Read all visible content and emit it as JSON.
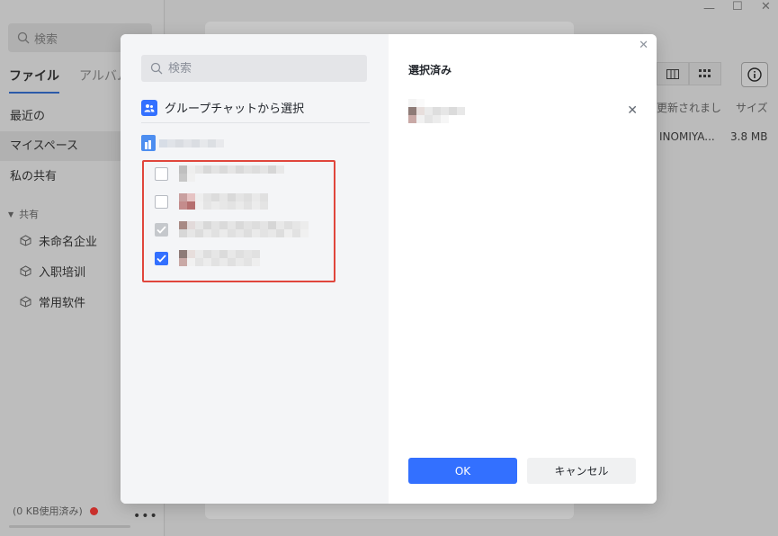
{
  "sidebar": {
    "search_placeholder": "検索",
    "tabs": [
      {
        "label": "ファイル",
        "active": true
      },
      {
        "label": "アルバム",
        "active": false
      }
    ],
    "items": [
      {
        "label": "最近の"
      },
      {
        "label": "マイスペース",
        "active": true
      },
      {
        "label": "私の共有"
      }
    ],
    "shared_group": "共有",
    "shared_items": [
      {
        "label": "未命名企业"
      },
      {
        "label": "入职培训"
      },
      {
        "label": "常用软件"
      }
    ],
    "quota_text": "(0 KB使用済み)"
  },
  "main": {
    "columns": {
      "updated": "更新されまし",
      "size": "サイズ"
    },
    "row": {
      "name_tail": "INOMIYA...",
      "size": "3.8 MB"
    }
  },
  "modal": {
    "search_placeholder": "検索",
    "group_chat_select": "グループチャットから選択",
    "selected_title": "選択済み",
    "ok_label": "OK",
    "cancel_label": "キャンセル",
    "members": [
      {
        "state": "unchecked"
      },
      {
        "state": "unchecked"
      },
      {
        "state": "disabled"
      },
      {
        "state": "checked"
      }
    ]
  },
  "colors": {
    "accent": "#3370ff",
    "highlight": "#e0463c"
  }
}
